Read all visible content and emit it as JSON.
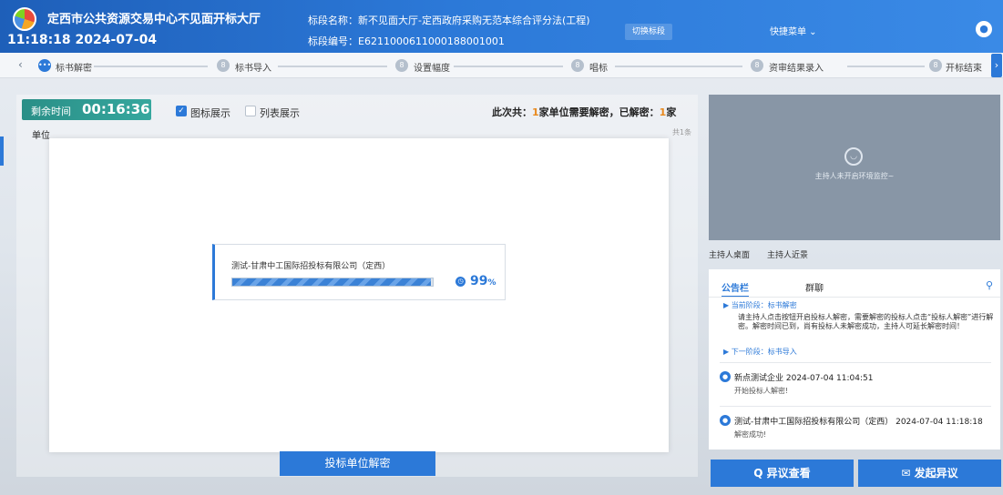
{
  "header": {
    "hall_title": "定西市公共资源交易中心不见面开标大厅",
    "clock": "11:18:18 2024-07-04",
    "bid_name": "标段名称：新不见面大厅-定西政府采购无范本综合评分法(工程)",
    "bid_no": "标段编号：E6211000611000188001001",
    "switch_label": "切换标段",
    "quick_menu": "快捷菜单 ⌄"
  },
  "stepper": {
    "steps": [
      {
        "label": "标书解密",
        "active": true
      },
      {
        "label": "标书导入",
        "active": false
      },
      {
        "label": "设置幅度",
        "active": false
      },
      {
        "label": "唱标",
        "active": false
      },
      {
        "label": "资审结果录入",
        "active": false
      },
      {
        "label": "开标结束",
        "active": false
      }
    ]
  },
  "main": {
    "time_label": "剩余时间",
    "time_value": "00:16:36",
    "view_icon": "图标展示",
    "view_list": "列表展示",
    "summary_prefix": "此次共：",
    "summary_total": "1",
    "summary_mid": "家单位需要解密，已解密：",
    "summary_done": "1",
    "summary_suffix": "家",
    "unit_label": "单位",
    "count_right": "共1条",
    "company": "测试-甘肃中工国际招投标有限公司（定西）",
    "progress": 99,
    "progress_text": "99",
    "progress_unit": "%",
    "bottom_button": "投标单位解密"
  },
  "video": {
    "text": "主持人未开启环境监控~"
  },
  "host_tabs": [
    "主持人桌面",
    "主持人近景"
  ],
  "notice": {
    "tab_notice": "公告栏",
    "tab_chat": "群聊",
    "current_stage": "▶ 当前阶段：标书解密",
    "text": "请主持人点击按钮开启投标人解密，需要解密的投标人点击“投标人解密”进行解密。解密时间已到，尚有投标人未解密成功，主持人可延长解密时间！",
    "next_stage": "▶ 下一阶段：标书导入",
    "messages": [
      {
        "head": "新点测试企业  2024-07-04 11:04:51",
        "body": "开始投标人解密!"
      },
      {
        "head": "测试-甘肃中工国际招投标有限公司（定西）  2024-07-04 11:18:18",
        "body": "解密成功!"
      }
    ]
  },
  "actions": {
    "dispute_view": "Q 异议查看",
    "raise_dispute": "发起异议"
  },
  "colors": {
    "primary": "#2c79d8",
    "timer": "#2a8f87",
    "highlight": "#e8891d"
  }
}
